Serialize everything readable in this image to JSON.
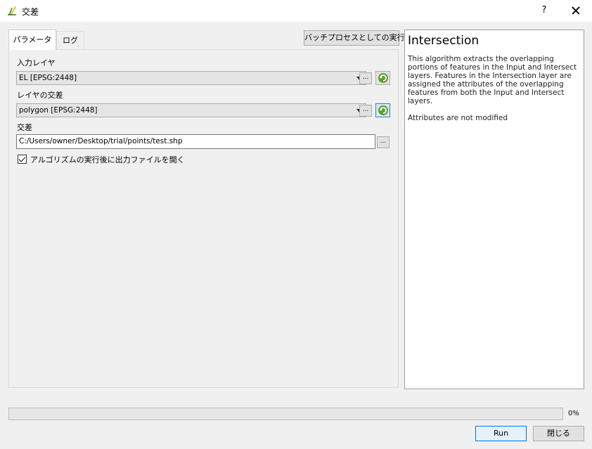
{
  "window": {
    "title": "交差",
    "help_symbol": "?"
  },
  "tabs": [
    {
      "label": "パラメータ",
      "selected": true
    },
    {
      "label": "ログ",
      "selected": false
    }
  ],
  "batch_button_label": "バッチプロセスとしての実行...",
  "params": {
    "input_layer": {
      "label": "入力レイヤ",
      "value": "EL [EPSG:2448]"
    },
    "intersect_layer": {
      "label": "レイヤの交差",
      "value": "polygon [EPSG:2448]"
    },
    "output": {
      "label": "交差",
      "value": "C:/Users/owner/Desktop/trial/points/test.shp"
    },
    "open_output": {
      "label": "アルゴリズムの実行後に出力ファイルを開く",
      "checked": true
    },
    "browse_label": "..."
  },
  "help": {
    "title": "Intersection",
    "description": "This algorithm extracts the overlapping portions of features in the Input and Intersect layers. Features in the Intersection layer are assigned the attributes of the overlapping features from both the Input and Intersect layers.",
    "attributes_note": "Attributes are not modified"
  },
  "progress": {
    "value": 0,
    "text": "0%"
  },
  "buttons": {
    "run": "Run",
    "close": "閉じる"
  },
  "icons": {
    "app": "qgis-processing-icon",
    "iterate": "iterate-over-features-icon",
    "close": "close-icon"
  },
  "colors": {
    "accent": "#0078d7",
    "iterate_green": "#5aa02c"
  }
}
